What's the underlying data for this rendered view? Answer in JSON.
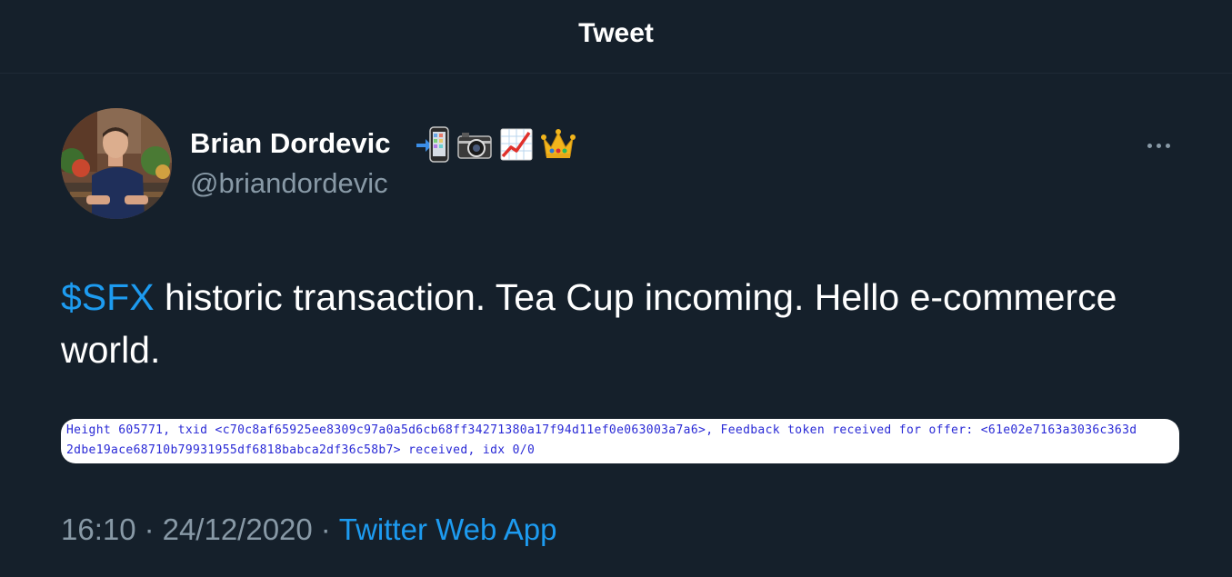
{
  "header": {
    "title": "Tweet"
  },
  "author": {
    "display_name": "Brian Dordevic",
    "handle": "@briandordevic",
    "name_emojis": [
      "mobile-phone-arrow-icon",
      "camera-icon",
      "chart-increasing-icon",
      "crown-icon"
    ]
  },
  "tweet": {
    "cashtag": "$SFX",
    "text": " historic transaction. Tea Cup incoming. Hello e-commerce world."
  },
  "attachment": {
    "line1": "Height 605771, txid <c70c8af65925ee8309c97a0a5d6cb68ff34271380a17f94d11ef0e063003a7a6>, Feedback token received for offer: <61e02e7163a3036c363d",
    "line2": "2dbe19ace68710b79931955df6818babca2df36c58b7> received, idx 0/0"
  },
  "meta": {
    "time": "16:10",
    "separator": "·",
    "date": "24/12/2020",
    "source": "Twitter Web App"
  },
  "colors": {
    "background": "#15202b",
    "link": "#1d9bf0",
    "secondary_text": "#8899a6"
  }
}
